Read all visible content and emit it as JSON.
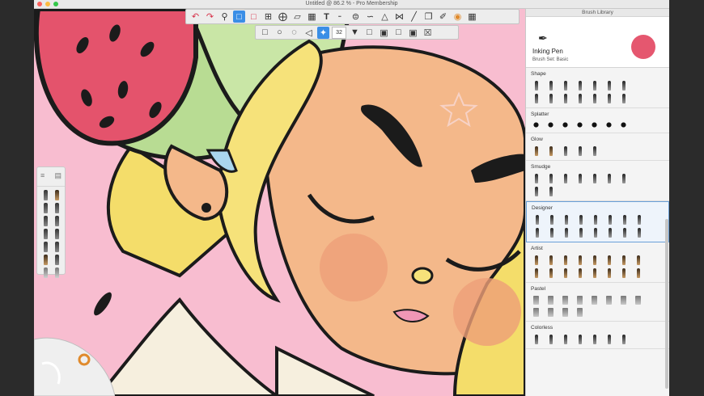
{
  "window": {
    "title": "Untitled @ 86.2 % - Pro Membership"
  },
  "icons": {
    "toolbar_main": [
      "undo-icon",
      "redo-icon",
      "zoom-icon",
      "select-icon",
      "lasso-icon",
      "crop-icon",
      "transform-icon",
      "perspective-icon",
      "layers-icon",
      "text-icon",
      "ruler-icon",
      "symmetry-icon",
      "curve-icon",
      "perspective-grid-icon",
      "flip-icon",
      "stroke-icon",
      "copy-icon",
      "brush-icon",
      "color-wheel-icon",
      "grid-icon"
    ],
    "toolbar_select": [
      "rect-select-icon",
      "ellipse-select-icon",
      "lasso-select-icon",
      "polygon-select-icon",
      "magic-wand-icon",
      "feather-icon",
      "fill-icon",
      "invert-icon",
      "crop-sel-icon",
      "clear-icon",
      "transform-sel-icon",
      "close-icon"
    ]
  },
  "select_toolbar": {
    "feather_value": "32"
  },
  "brush_library": {
    "title": "Brush Library",
    "current_brush": {
      "name": "Inking Pen",
      "set": "Brush Set: Basic",
      "color": "#e5576f"
    },
    "sets": [
      {
        "name": "Shape",
        "rows": [
          [
            "pen",
            "spiky",
            "grass",
            "circle",
            "star",
            "burst",
            "dots"
          ],
          [
            "dots",
            "pen",
            "pen",
            "pen",
            "pen",
            "pen",
            "pen"
          ]
        ]
      },
      {
        "name": "Splatter",
        "rows": [
          [
            "splat",
            "splat",
            "splat",
            "splat",
            "splat",
            "splat",
            "splat"
          ]
        ]
      },
      {
        "name": "Glow",
        "rows": [
          [
            "tan",
            "tan",
            "squiggle",
            "ring",
            "cross"
          ]
        ]
      },
      {
        "name": "Smudge",
        "rows": [
          [
            "pen",
            "pen",
            "pen",
            "pen",
            "pen",
            "pen",
            "pen"
          ],
          [
            "pen",
            "pen"
          ]
        ]
      },
      {
        "name": "Designer",
        "rows": [
          [
            "pen",
            "pen",
            "pen",
            "pen",
            "pen",
            "pen",
            "pen",
            "pen"
          ],
          [
            "pen",
            "pen",
            "pen",
            "pen",
            "pen",
            "pen",
            "pen",
            "pen"
          ]
        ]
      },
      {
        "name": "Artist",
        "rows": [
          [
            "tan",
            "tan",
            "tan",
            "tan",
            "tan",
            "tan",
            "tan",
            "tan"
          ],
          [
            "tan",
            "tan",
            "tan",
            "tan",
            "tan",
            "tan",
            "tan",
            "tan"
          ]
        ]
      },
      {
        "name": "Pastel",
        "rows": [
          [
            "gr",
            "gr",
            "gr",
            "gr",
            "gr",
            "gr",
            "gr",
            "gr"
          ],
          [
            "gr",
            "gr",
            "gr",
            "gr"
          ]
        ]
      },
      {
        "name": "Colorless",
        "rows": [
          [
            "pen",
            "pen",
            "pen",
            "pen",
            "pen",
            "pen",
            "pen"
          ]
        ]
      }
    ],
    "selected_set": "Designer"
  }
}
